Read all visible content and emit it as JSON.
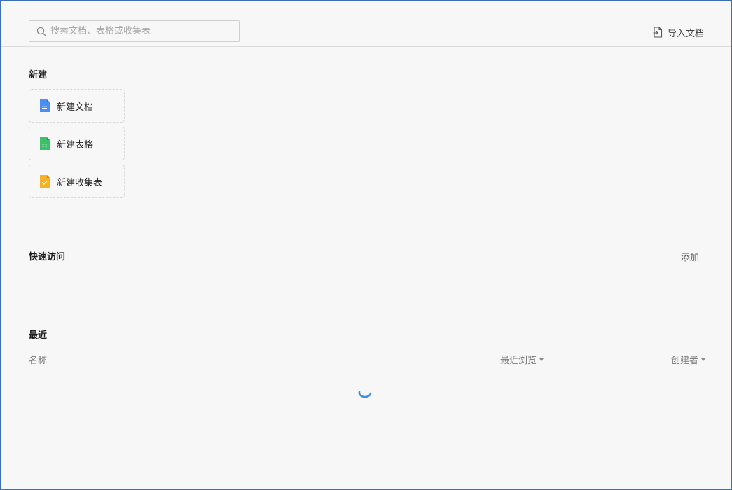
{
  "header": {
    "search_placeholder": "搜索文档、表格或收集表",
    "import_label": "导入文档"
  },
  "new_section": {
    "title": "新建",
    "items": [
      {
        "label": "新建文档",
        "icon": "doc-icon",
        "color": "#4a8ef5"
      },
      {
        "label": "新建表格",
        "icon": "sheet-icon",
        "color": "#3cc06a"
      },
      {
        "label": "新建收集表",
        "icon": "form-icon",
        "color": "#f6b124"
      }
    ]
  },
  "quick_access": {
    "title": "快速访问",
    "add_label": "添加"
  },
  "recent": {
    "title": "最近",
    "columns": {
      "name": "名称",
      "last_viewed": "最近浏览",
      "creator": "创建者"
    }
  },
  "accent_color": "#3d8fe6"
}
